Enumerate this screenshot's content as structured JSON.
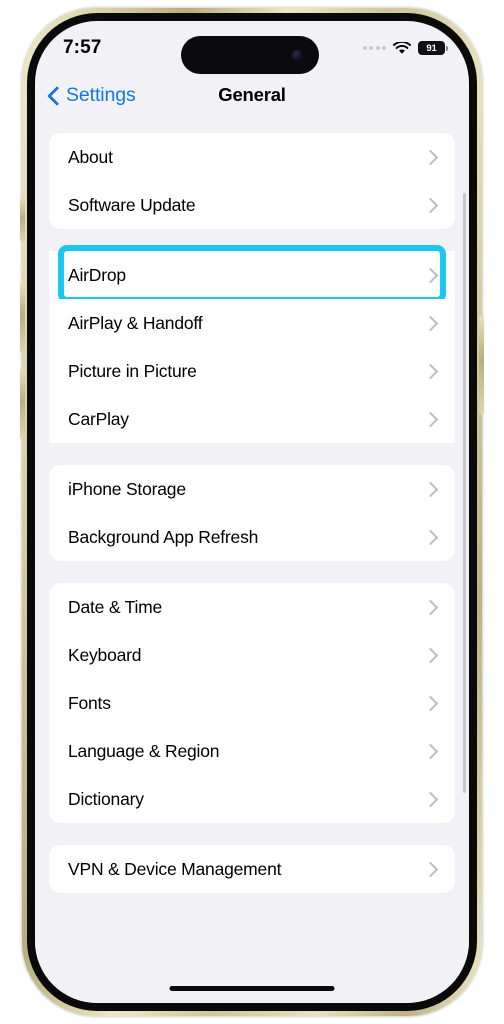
{
  "status_bar": {
    "time": "7:57",
    "cellular_icon": "cellular-dots-icon",
    "wifi_icon": "wifi-icon",
    "battery_level": "91",
    "battery_icon": "battery-icon"
  },
  "dynamic_island": {
    "camera_icon": "front-camera-icon"
  },
  "nav": {
    "back_icon": "chevron-left-icon",
    "back_label": "Settings",
    "title": "General"
  },
  "colors": {
    "accent_blue": "#1277e8",
    "highlight_cyan": "#1bc6f2",
    "page_background": "#f1f1f6",
    "card_background": "#ffffff",
    "chevron_gray": "#bcbcc2"
  },
  "groups": [
    {
      "id": "group-info",
      "rows": [
        {
          "label": "About",
          "name": "settings-row-about",
          "highlighted": false
        },
        {
          "label": "Software Update",
          "name": "settings-row-software-update",
          "highlighted": false
        }
      ]
    },
    {
      "id": "group-connectivity",
      "rows": [
        {
          "label": "AirDrop",
          "name": "settings-row-airdrop",
          "highlighted": true
        },
        {
          "label": "AirPlay & Handoff",
          "name": "settings-row-airplay-handoff",
          "highlighted": false
        },
        {
          "label": "Picture in Picture",
          "name": "settings-row-picture-in-picture",
          "highlighted": false
        },
        {
          "label": "CarPlay",
          "name": "settings-row-carplay",
          "highlighted": false
        }
      ]
    },
    {
      "id": "group-storage",
      "rows": [
        {
          "label": "iPhone Storage",
          "name": "settings-row-iphone-storage",
          "highlighted": false
        },
        {
          "label": "Background App Refresh",
          "name": "settings-row-background-app-refresh",
          "highlighted": false
        }
      ]
    },
    {
      "id": "group-locale",
      "rows": [
        {
          "label": "Date & Time",
          "name": "settings-row-date-time",
          "highlighted": false
        },
        {
          "label": "Keyboard",
          "name": "settings-row-keyboard",
          "highlighted": false
        },
        {
          "label": "Fonts",
          "name": "settings-row-fonts",
          "highlighted": false
        },
        {
          "label": "Language & Region",
          "name": "settings-row-language-region",
          "highlighted": false
        },
        {
          "label": "Dictionary",
          "name": "settings-row-dictionary",
          "highlighted": false
        }
      ]
    },
    {
      "id": "group-management",
      "rows": [
        {
          "label": "VPN & Device Management",
          "name": "settings-row-vpn-device-management",
          "highlighted": false
        }
      ]
    }
  ],
  "device": {
    "action_button": "action-button",
    "volume_up_button": "volume-up-button",
    "volume_down_button": "volume-down-button",
    "power_button": "power-button",
    "home_indicator": "home-indicator",
    "scroll_indicator": "scroll-indicator"
  }
}
